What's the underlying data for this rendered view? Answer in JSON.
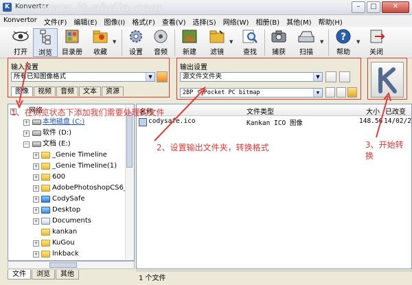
{
  "window": {
    "title": "Konvertor",
    "watermark": "www.it.nhdla.com",
    "min": "–",
    "max": "□",
    "close": "✕"
  },
  "menu": [
    "Konvertor",
    "文件(F)",
    "编辑(E)",
    "图像(I)",
    "格式(F)",
    "查看(V)",
    "选择(S)",
    "网络(W)",
    "相册(B)",
    "其他(M)",
    "帮助(H)"
  ],
  "toolbar": {
    "open": "打开",
    "browse": "浏览",
    "catalog": "目录册",
    "favorite": "收藏",
    "settings": "设置",
    "audio": "音频",
    "new": "新建",
    "filter": "滤镜",
    "find": "查找",
    "capture": "捕获",
    "scan": "扫描",
    "help": "帮助",
    "close": "关闭"
  },
  "input_settings": {
    "label": "输入设置",
    "value": "所有已知图像格式",
    "tabs": [
      "图像",
      "视频",
      "音频",
      "文本",
      "资源"
    ]
  },
  "output_settings": {
    "label": "输出设置",
    "folder": "源文件文件夹",
    "format": "2BP - Pocket PC bitmap"
  },
  "tree": {
    "items": [
      {
        "label": "网络",
        "level": 0
      },
      {
        "label": "本地磁盘 (C:)",
        "level": 1
      },
      {
        "label": "软件 (D:)",
        "level": 1
      },
      {
        "label": "文档 (E:)",
        "level": 1
      },
      {
        "label": "_Genie Timeline",
        "level": 2
      },
      {
        "label": "_Genie Timeline(1)",
        "level": 2
      },
      {
        "label": "600",
        "level": 2
      },
      {
        "label": "AdobePhotoshopCS6_1",
        "level": 2
      },
      {
        "label": "CodySafe",
        "level": 2
      },
      {
        "label": "Desktop",
        "level": 2
      },
      {
        "label": "Documents",
        "level": 2
      },
      {
        "label": "kankan",
        "level": 2
      },
      {
        "label": "KuGou",
        "level": 2
      },
      {
        "label": "lnkback",
        "level": 2
      }
    ]
  },
  "filelist": {
    "columns": [
      "名称",
      "文件类型",
      "大小",
      "已改变"
    ],
    "rows": [
      {
        "name": "codysafe.ico",
        "type": "Kankan ICO 图像",
        "size": "148.56",
        "date": "14/02/2"
      }
    ]
  },
  "bottom_tabs": [
    "文件",
    "浏览",
    "其他"
  ],
  "status": "1 个文件",
  "annotations": {
    "step1": "1、在浏览状态下添加我们需要处理的文件",
    "step2": "2、设置输出文件夹，转换格式",
    "step3a": "3、开始转",
    "step3b": "换"
  },
  "colors": {
    "annotation": "#e53935",
    "accent": "#2d5fa8"
  }
}
